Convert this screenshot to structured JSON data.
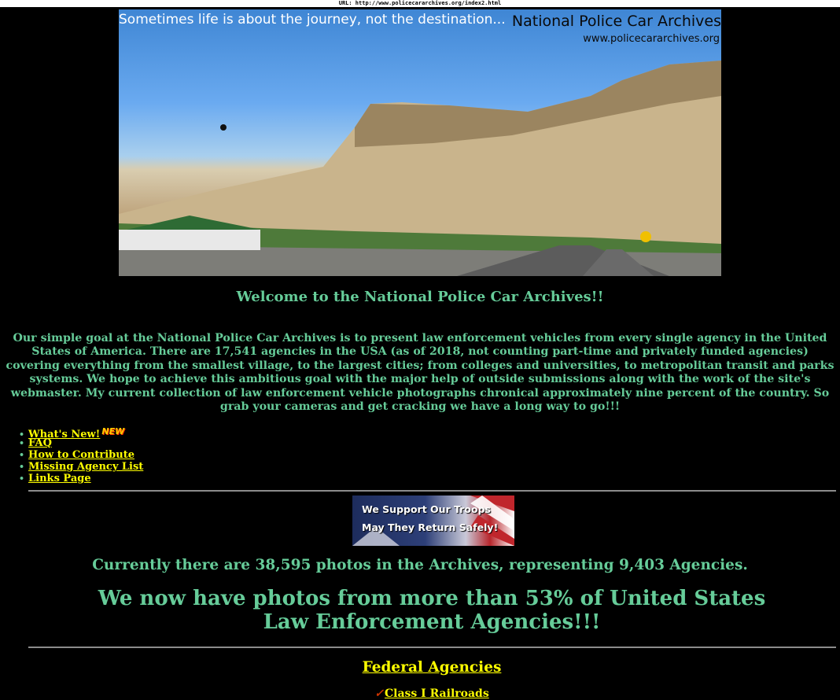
{
  "url_bar": "URL: http://www.policecararchives.org/index2.html",
  "banner": {
    "tagline": "Sometimes life is about the journey, not the destination...",
    "brand": "National Police Car Archives",
    "site": "www.policecararchives.org"
  },
  "welcome": "Welcome to the National Police Car Archives!!",
  "intro": "Our simple goal at the National Police Car Archives is to present law enforcement vehicles from every single agency in the United States of America. There are 17,541 agencies in the USA (as of 2018, not counting part-time and privately funded agencies) covering everything from the smallest village, to the largest cities; from colleges and universities, to metropolitan transit and parks systems. We hope to achieve this ambitious goal with the major help of outside submissions along with the work of the site's webmaster. My current collection of law enforcement vehicle photographs chronical approximately nine percent of the country. So grab your cameras and get cracking we have a long way to go!!!",
  "nav": {
    "whats_new": "What's New!",
    "new_badge": "NEW",
    "faq": "FAQ",
    "contribute": "How to Contribute",
    "missing": "Missing Agency List",
    "links": "Links Page"
  },
  "troops_banner": {
    "line1": "We Support Our Troops",
    "line2": "May They Return Safely!"
  },
  "photo_count": "Currently there are 38,595 photos in the Archives, representing 9,403 Agencies.",
  "percent_note": "We now have photos from more than 53% of United States Law Enforcement Agencies!!!",
  "sections": {
    "federal": "Federal Agencies",
    "railroads": "Class I Railroads"
  },
  "colors": {
    "background": "#000000",
    "text_green": "#66cc99",
    "link_yellow": "#ffff00"
  }
}
